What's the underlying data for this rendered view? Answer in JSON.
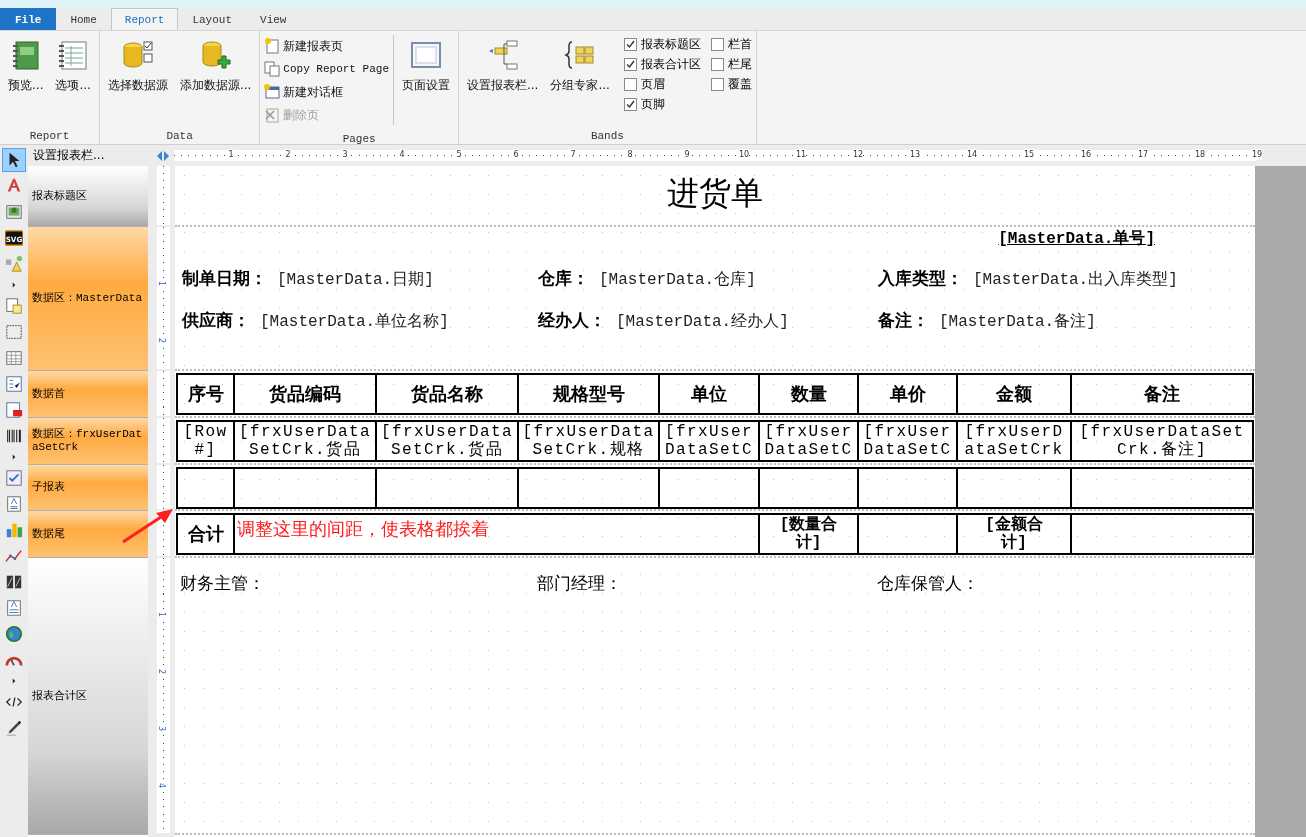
{
  "tabs": [
    {
      "label": "File",
      "kind": "file",
      "selected": false
    },
    {
      "label": "Home",
      "kind": "tab",
      "selected": false
    },
    {
      "label": "Report",
      "kind": "tab",
      "selected": true
    },
    {
      "label": "Layout",
      "kind": "tab",
      "selected": false
    },
    {
      "label": "View",
      "kind": "tab",
      "selected": false
    }
  ],
  "ribbon": [
    {
      "title": "Report",
      "columns": [
        {
          "kind": "large",
          "label": "预览..."
        },
        {
          "kind": "large",
          "label": "选项..."
        }
      ]
    },
    {
      "title": "Data",
      "columns": [
        {
          "kind": "large",
          "label": "选择数据源"
        },
        {
          "kind": "large",
          "label": "添加数据源..."
        }
      ]
    },
    {
      "title": "Pages",
      "columns": [
        {
          "kind": "list",
          "items": [
            {
              "label": "新建报表页",
              "disabled": false
            },
            {
              "label": "Copy Report Page",
              "disabled": false
            },
            {
              "label": "新建对话框",
              "disabled": false
            },
            {
              "label": "删除页",
              "disabled": true
            }
          ]
        },
        {
          "kind": "large",
          "label": "页面设置"
        }
      ]
    },
    {
      "title": "Bands",
      "columns": [
        {
          "kind": "large",
          "label": "设置报表栏..."
        },
        {
          "kind": "large",
          "label": "分组专家..."
        },
        {
          "kind": "checks",
          "items": [
            {
              "label": "报表标题区",
              "checked": true
            },
            {
              "label": "报表合计区",
              "checked": true
            },
            {
              "label": "页眉",
              "checked": false
            },
            {
              "label": "页脚",
              "checked": true
            }
          ]
        },
        {
          "kind": "checks",
          "items": [
            {
              "label": "栏首",
              "checked": false
            },
            {
              "label": "栏尾",
              "checked": false
            },
            {
              "label": "覆盖",
              "checked": false
            }
          ]
        }
      ]
    }
  ],
  "tools": [
    {
      "selected": true
    },
    {
      "selected": false
    },
    {
      "selected": false
    },
    {
      "selected": false,
      "label": "SVG"
    },
    {
      "selected": false
    },
    {
      "selected": false
    },
    {
      "selected": false
    },
    {
      "selected": false
    },
    {
      "selected": false
    },
    {
      "selected": false
    },
    {
      "selected": false
    },
    {
      "selected": false
    },
    {
      "selected": false
    },
    {
      "selected": false
    },
    {
      "selected": false
    },
    {
      "selected": false
    },
    {
      "selected": false
    },
    {
      "selected": false
    },
    {
      "selected": false
    },
    {
      "selected": false
    },
    {
      "selected": false
    },
    {
      "selected": false
    },
    {
      "selected": false
    },
    {
      "selected": false
    }
  ],
  "band_panel": {
    "header": "设置报表栏..."
  },
  "bands": [
    {
      "label": "报表标题区",
      "kind": "report"
    },
    {
      "label": "数据区：MasterData",
      "kind": "data",
      "ruler_marks": [
        "1",
        "2"
      ]
    },
    {
      "label": "数据首",
      "kind": "data"
    },
    {
      "label": "数据区：frxUserDataSetCrk",
      "kind": "data"
    },
    {
      "label": "子报表",
      "kind": "data"
    },
    {
      "label": "数据尾",
      "kind": "data"
    },
    {
      "label": "报表合计区",
      "kind": "report",
      "ruler_marks": [
        "1",
        "2",
        "3",
        "4"
      ]
    }
  ],
  "ruler": {
    "marks": [
      "1",
      "2",
      "3",
      "4",
      "5",
      "6",
      "7",
      "8",
      "9",
      "10",
      "11",
      "12",
      "13",
      "14",
      "15",
      "16",
      "17",
      "18",
      "19"
    ]
  },
  "report": {
    "title": "进货单",
    "order_no": "[MasterData.单号]",
    "fields": [
      {
        "label": "制单日期：",
        "value": "[MasterData.日期]"
      },
      {
        "label": "仓库：",
        "value": "[MasterData.仓库]"
      },
      {
        "label": "入库类型：",
        "value": "[MasterData.出入库类型]"
      },
      {
        "label": "供应商：",
        "value": "[MasterData.单位名称]"
      },
      {
        "label": "经办人：",
        "value": "[MasterData.经办人]"
      },
      {
        "label": "备注：",
        "value": "[MasterData.备注]"
      }
    ],
    "table": {
      "header": [
        "序号",
        "货品编码",
        "货品名称",
        "规格型号",
        "单位",
        "数量",
        "单价",
        "金额",
        "备注"
      ],
      "data_row": [
        "[Row#]",
        "[frxUserDataSetCrk.货品",
        "[frxUserDataSetCrk.货品",
        "[frxUserDataSetCrk.规格",
        "[frxUserDataSetC",
        "[frxUserDataSetC",
        "[frxUserDataSetC",
        "[frxUserDataSetCrk",
        "[frxUserDataSetCrk.备注]"
      ],
      "footer": {
        "label": "合计",
        "qty_total": "[数量合计]",
        "amount_total": "[金额合计]"
      }
    },
    "signatures": [
      "财务主管：",
      "部门经理：",
      "仓库保管人："
    ]
  },
  "annotation": {
    "text": "调整这里的间距，使表格都挨着"
  }
}
